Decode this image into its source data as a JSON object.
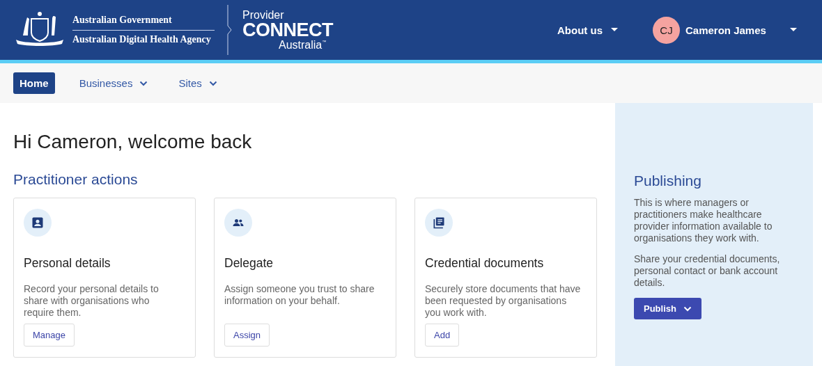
{
  "header": {
    "government": "Australian Government",
    "agency": "Australian Digital Health Agency",
    "product": {
      "line_1": "Provider",
      "line_2": "CONNECT",
      "line_3": "Australia",
      "trademark": "™"
    },
    "menu": {
      "label": "About us"
    },
    "user": {
      "initials": "CJ",
      "name": "Cameron James"
    }
  },
  "nav": [
    {
      "label": "Home",
      "selected": true,
      "dropdown": false
    },
    {
      "label": "Businesses",
      "selected": false,
      "dropdown": true
    },
    {
      "label": "Sites",
      "selected": false,
      "dropdown": true
    }
  ],
  "greeting": "Hi Cameron, welcome back",
  "section_title": "Practitioner actions",
  "cards": [
    {
      "kind": "person",
      "title": "Personal details",
      "description": "Record your personal details to share with organisations who require them.",
      "button": "Manage"
    },
    {
      "kind": "people",
      "title": "Delegate",
      "description": "Assign someone you trust to share information on your behalf.",
      "button": "Assign"
    },
    {
      "kind": "documents",
      "title": "Credential documents",
      "description": "Securely store documents that have been requested by organisations you work with.",
      "button": "Add"
    }
  ],
  "side_panel": {
    "title": "Publishing",
    "paragraphs": [
      "This is where managers or practitioners make healthcare provider information available to organisations they work with.",
      "Share your credential documents, personal contact or bank account details."
    ],
    "button": "Publish"
  }
}
